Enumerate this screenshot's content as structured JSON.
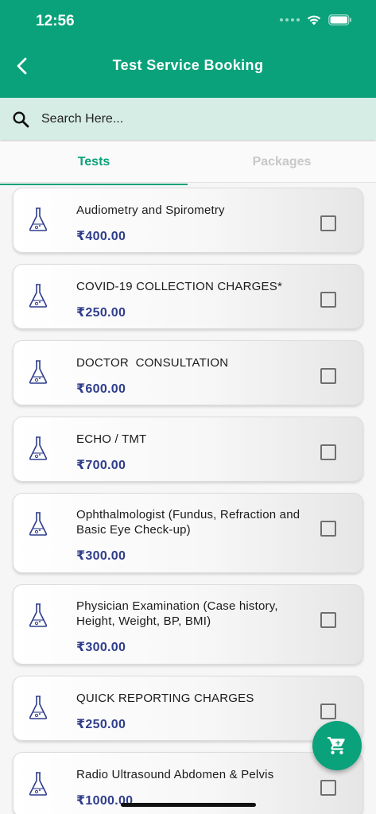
{
  "status_bar": {
    "time": "12:56"
  },
  "header": {
    "title": "Test Service Booking"
  },
  "search": {
    "placeholder": "Search Here..."
  },
  "tabs": [
    {
      "label": "Tests",
      "active": true
    },
    {
      "label": "Packages",
      "active": false
    }
  ],
  "tests": [
    {
      "name": "Audiometry and Spirometry",
      "price": "₹400.00",
      "checked": false
    },
    {
      "name": "COVID-19 COLLECTION CHARGES*",
      "price": "₹250.00",
      "checked": false
    },
    {
      "name": "DOCTOR  CONSULTATION",
      "price": "₹600.00",
      "checked": false
    },
    {
      "name": "ECHO / TMT",
      "price": "₹700.00",
      "checked": false
    },
    {
      "name": "Ophthalmologist (Fundus, Refraction and Basic Eye Check-up)",
      "price": "₹300.00",
      "checked": false
    },
    {
      "name": "Physician Examination (Case history, Height, Weight, BP, BMI)",
      "price": "₹300.00",
      "checked": false
    },
    {
      "name": "QUICK REPORTING CHARGES",
      "price": "₹250.00",
      "checked": false
    },
    {
      "name": "Radio Ultrasound Abdomen & Pelvis",
      "price": "₹1000.00",
      "checked": false
    }
  ],
  "icons": {
    "back": "chevron-left-icon",
    "search": "search-icon",
    "item": "flask-icon",
    "cart": "cart-icon"
  },
  "colors": {
    "primary": "#0aa27a",
    "search_bg": "#d6ede6",
    "price": "#2f3d8c"
  }
}
